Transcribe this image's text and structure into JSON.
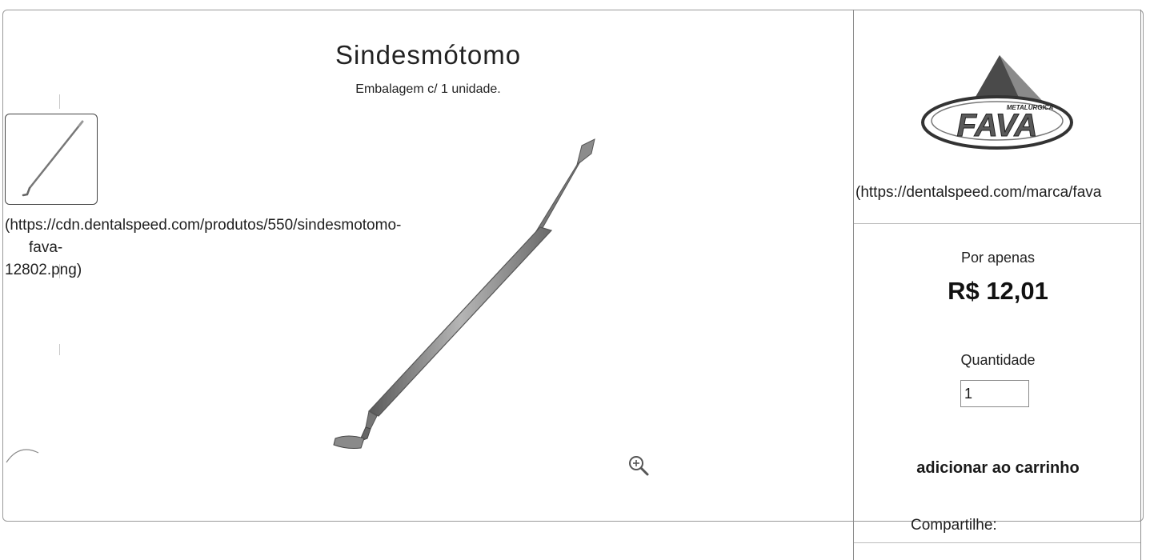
{
  "product": {
    "title": "Sindesmótomo",
    "subtitle": "Embalagem c/ 1 unidade.",
    "thumbnail_url_line1": "(https://cdn.dentalspeed.com/produtos/550/sindesmotomo-",
    "thumbnail_url_line2": "fava-",
    "thumbnail_url_line3": "12802.png)",
    "zoom_icon": "zoom-in-icon"
  },
  "sidebar": {
    "brand_logo_text": "FAVA",
    "brand_logo_small_text": "METALURGICA",
    "brand_url": "(https://dentalspeed.com/marca/fava",
    "price_label": "Por apenas",
    "price": "R$ 12,01",
    "quantity_label": "Quantidade",
    "quantity_value": "1",
    "add_to_cart_label": "adicionar ao carrinho",
    "share_label": "Compartilhe:"
  },
  "colors": {
    "logo_dark_gray": "#4a4a4a",
    "logo_mid_gray": "#8a8a8a",
    "text": "#1f1f1f"
  }
}
